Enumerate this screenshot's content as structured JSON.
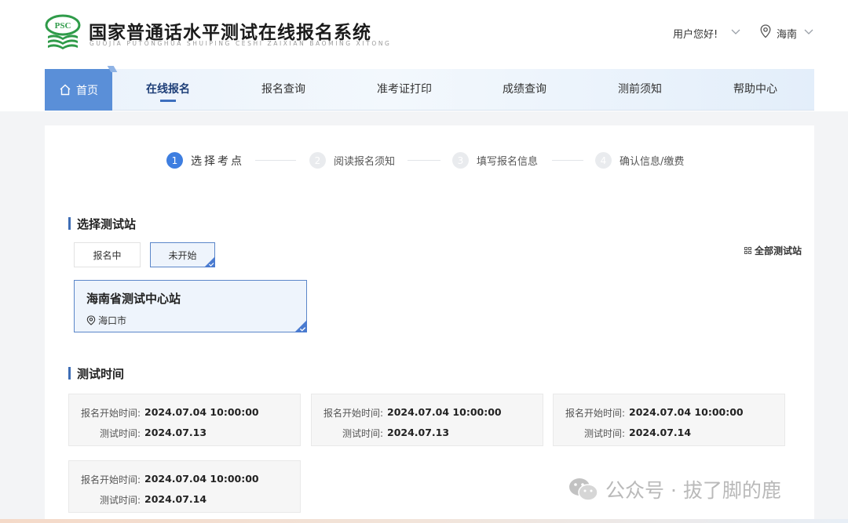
{
  "header": {
    "title": "国家普通话水平测试在线报名系统",
    "subtitle": "GUOJIA PUTONGHUA SHUIPING CESHI ZAIXIAN BAOMING XITONG",
    "logo_text": "PSC",
    "greeting": "用户您好!",
    "region": "海南"
  },
  "nav": {
    "home": "首页",
    "items": [
      "在线报名",
      "报名查询",
      "准考证打印",
      "成绩查询",
      "测前须知",
      "帮助中心"
    ]
  },
  "steps": [
    {
      "num": "1",
      "label": "选择考点"
    },
    {
      "num": "2",
      "label": "阅读报名须知"
    },
    {
      "num": "3",
      "label": "填写报名信息"
    },
    {
      "num": "4",
      "label": "确认信息/缴费"
    }
  ],
  "station_section": {
    "title": "选择测试站",
    "filters": [
      "报名中",
      "未开始"
    ],
    "all_link": "全部测试站",
    "station": {
      "name": "海南省测试中心站",
      "city": "海口市"
    }
  },
  "time_section": {
    "title": "测试时间",
    "start_label": "报名开始时间:",
    "test_label": "测试时间:",
    "sessions": [
      {
        "start": "2024.07.04 10:00:00",
        "test": "2024.07.13"
      },
      {
        "start": "2024.07.04 10:00:00",
        "test": "2024.07.13"
      },
      {
        "start": "2024.07.04 10:00:00",
        "test": "2024.07.14"
      },
      {
        "start": "2024.07.04 10:00:00",
        "test": "2024.07.14"
      }
    ]
  },
  "watermark": {
    "text": "公众号 · 拔了脚的鹿"
  },
  "colors": {
    "accent": "#3e7ee0",
    "nav_home": "#5a8fd8",
    "logo_green": "#2f9b49"
  }
}
